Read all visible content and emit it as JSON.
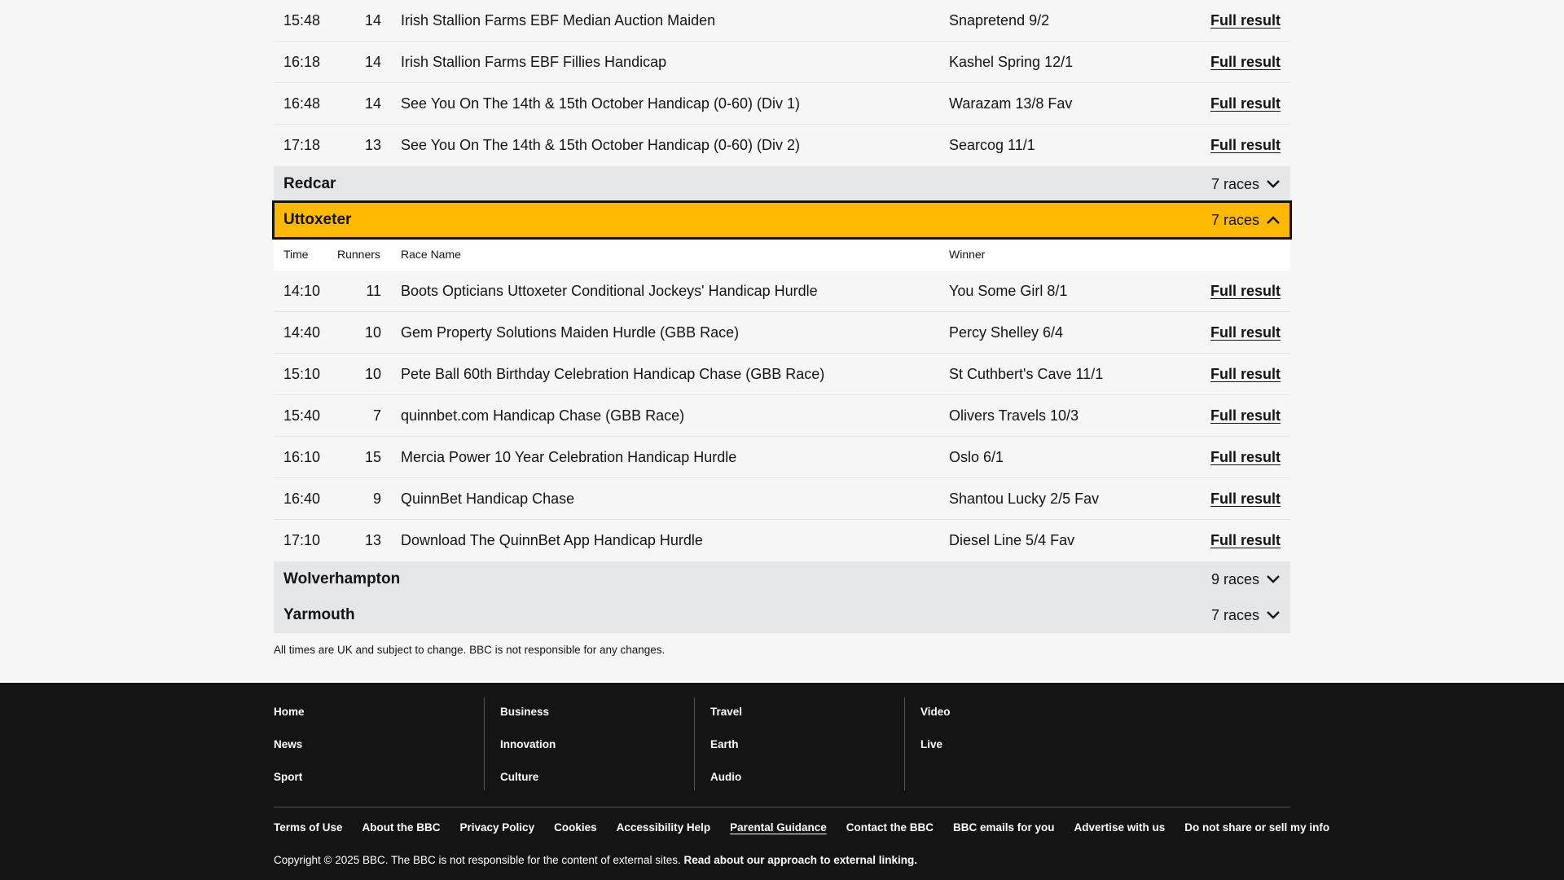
{
  "upper_rows": [
    {
      "time": "15:48",
      "runners": "14",
      "name": "Irish Stallion Farms EBF Median Auction Maiden",
      "winner": "Snapretend 9/2",
      "link": "Full result"
    },
    {
      "time": "16:18",
      "runners": "14",
      "name": "Irish Stallion Farms EBF Fillies Handicap",
      "winner": "Kashel Spring 12/1",
      "link": "Full result"
    },
    {
      "time": "16:48",
      "runners": "14",
      "name": "See You On The 14th & 15th October Handicap (0-60) (Div 1)",
      "winner": "Warazam 13/8 Fav",
      "link": "Full result"
    },
    {
      "time": "17:18",
      "runners": "13",
      "name": "See You On The 14th & 15th October Handicap (0-60) (Div 2)",
      "winner": "Searcog 11/1",
      "link": "Full result"
    }
  ],
  "meetings": {
    "redcar": {
      "name": "Redcar",
      "count": "7 races"
    },
    "uttoxeter": {
      "name": "Uttoxeter",
      "count": "7 races"
    },
    "wolverhampton": {
      "name": "Wolverhampton",
      "count": "9 races"
    },
    "yarmouth": {
      "name": "Yarmouth",
      "count": "7 races"
    }
  },
  "table_headers": {
    "time": "Time",
    "runners": "Runners",
    "name": "Race Name",
    "winner": "Winner"
  },
  "uttoxeter_rows": [
    {
      "time": "14:10",
      "runners": "11",
      "name": "Boots Opticians Uttoxeter Conditional Jockeys' Handicap Hurdle",
      "winner": "You Some Girl 8/1",
      "link": "Full result"
    },
    {
      "time": "14:40",
      "runners": "10",
      "name": "Gem Property Solutions Maiden Hurdle (GBB Race)",
      "winner": "Percy Shelley 6/4",
      "link": "Full result"
    },
    {
      "time": "15:10",
      "runners": "10",
      "name": "Pete Ball 60th Birthday Celebration Handicap Chase (GBB Race)",
      "winner": "St Cuthbert's Cave 11/1",
      "link": "Full result"
    },
    {
      "time": "15:40",
      "runners": "7",
      "name": "quinnbet.com Handicap Chase (GBB Race)",
      "winner": "Olivers Travels 10/3",
      "link": "Full result"
    },
    {
      "time": "16:10",
      "runners": "15",
      "name": "Mercia Power 10 Year Celebration Handicap Hurdle",
      "winner": "Oslo 6/1",
      "link": "Full result"
    },
    {
      "time": "16:40",
      "runners": "9",
      "name": "QuinnBet Handicap Chase",
      "winner": "Shantou Lucky 2/5 Fav",
      "link": "Full result"
    },
    {
      "time": "17:10",
      "runners": "13",
      "name": "Download The QuinnBet App Handicap Hurdle",
      "winner": "Diesel Line 5/4 Fav",
      "link": "Full result"
    }
  ],
  "note": "All times are UK and subject to change. BBC is not responsible for any changes.",
  "footer": {
    "col1": [
      "Home",
      "News",
      "Sport"
    ],
    "col2": [
      "Business",
      "Innovation",
      "Culture"
    ],
    "col3": [
      "Travel",
      "Earth",
      "Audio"
    ],
    "col4": [
      "Video",
      "Live"
    ],
    "links": [
      "Terms of Use",
      "About the BBC",
      "Privacy Policy",
      "Cookies",
      "Accessibility Help",
      "Parental Guidance",
      "Contact the BBC",
      "BBC emails for you",
      "Advertise with us",
      "Do not share or sell my info"
    ],
    "copyright": "Copyright © 2025 BBC. The BBC is not responsible for the content of external sites.",
    "external_link": "Read about our approach to external linking."
  },
  "icons": {
    "collapsed": "chevron-down-icon",
    "expanded": "chevron-up-icon"
  },
  "colors": {
    "accent": "#ffb900",
    "footer_bg": "#141414",
    "meeting_bg": "#e5e6e8"
  }
}
